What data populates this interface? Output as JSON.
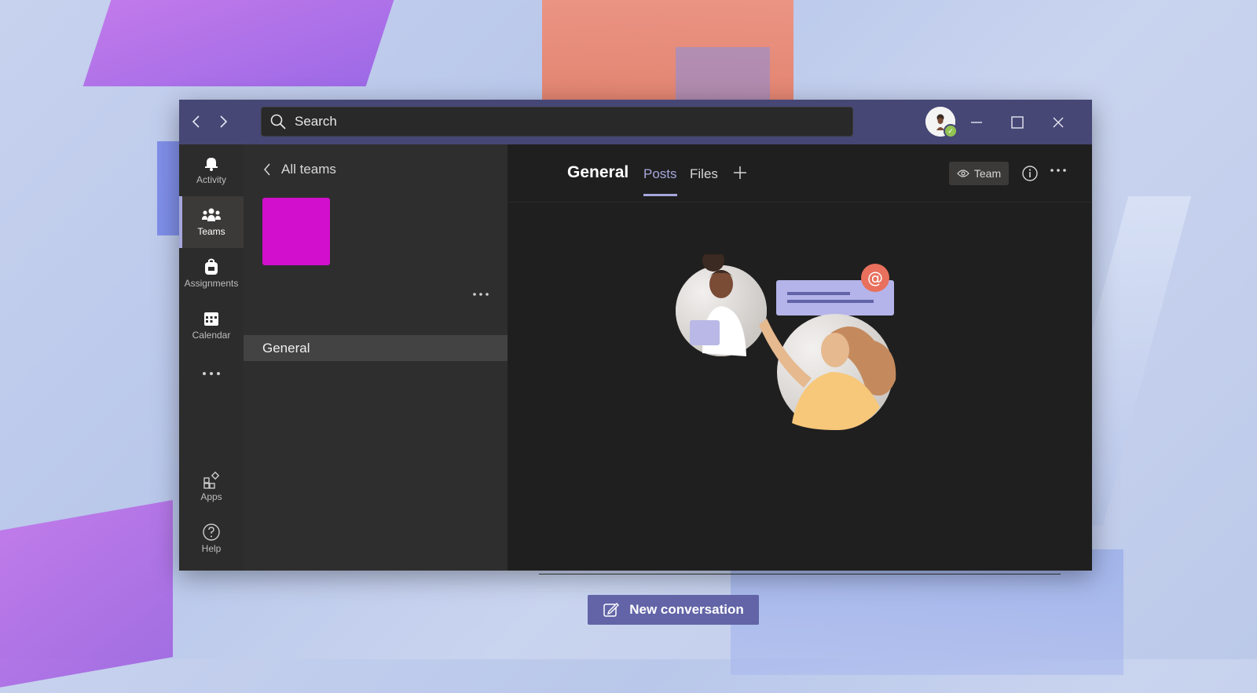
{
  "search": {
    "placeholder": "Search"
  },
  "rail": {
    "items": [
      {
        "label": "Activity",
        "icon": "bell-icon"
      },
      {
        "label": "Teams",
        "icon": "teams-icon",
        "active": true
      },
      {
        "label": "Assignments",
        "icon": "backpack-icon"
      },
      {
        "label": "Calendar",
        "icon": "calendar-icon"
      },
      {
        "label": "Apps",
        "icon": "apps-icon"
      },
      {
        "label": "Help",
        "icon": "help-icon"
      }
    ]
  },
  "panel": {
    "back_label": "All teams",
    "team_color": "#d20fcc",
    "channels": [
      {
        "name": "General",
        "selected": true
      }
    ]
  },
  "main": {
    "channel_title": "General",
    "tabs": [
      {
        "label": "Posts",
        "active": true
      },
      {
        "label": "Files",
        "active": false
      }
    ],
    "team_button": "Team",
    "new_conversation": "New conversation"
  },
  "colors": {
    "titlebar": "#464775",
    "accent": "#6264a7",
    "tab_active": "#a6a7dc",
    "presence": "#92c353"
  }
}
